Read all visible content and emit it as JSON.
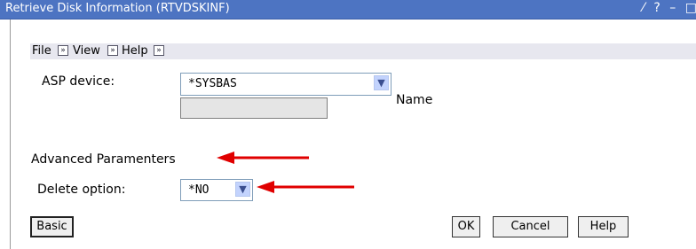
{
  "window": {
    "title": "Retrieve Disk Information (RTVDSKINF)",
    "controls": "⁄ ? – □"
  },
  "menu": {
    "items": [
      "File",
      "View",
      "Help"
    ],
    "arrow_glyph": "»"
  },
  "asp": {
    "label": "ASP device:",
    "value": "*SYSBAS",
    "name_label": "Name",
    "name_value": ""
  },
  "advanced": {
    "heading": "Advanced Paramenters"
  },
  "delete": {
    "label": "Delete option:",
    "value": "*NO"
  },
  "buttons": {
    "basic": "Basic",
    "ok": "OK",
    "cancel": "Cancel",
    "help": "Help"
  },
  "colors": {
    "titlebar": "#4d74c2",
    "menubar": "#e7e7ef",
    "annotation_arrow": "#e00000"
  },
  "icons": [
    "dropdown-chevron-icon",
    "menu-expand-icon",
    "red-arrow-icon"
  ]
}
